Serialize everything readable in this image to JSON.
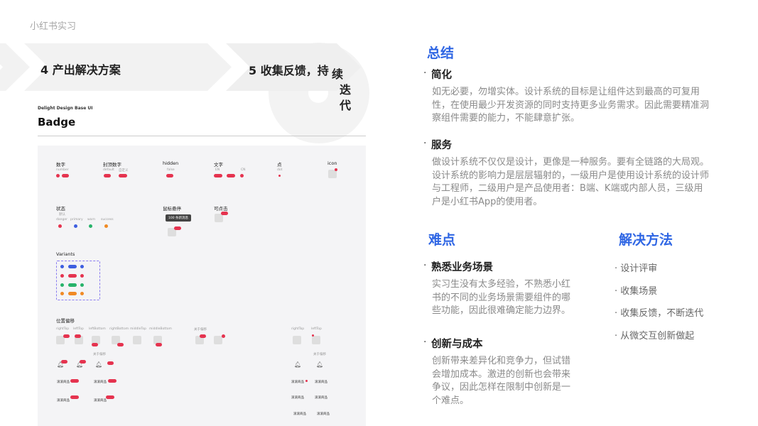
{
  "header": {
    "label": "小红书实习"
  },
  "process": {
    "step4": "4 产出解决方案",
    "step5_line1": "5 收集反馈，持",
    "step5_line2": "续",
    "step5_line3": "迭",
    "step5_line4": "代"
  },
  "doc": {
    "subtitle": "Delight Design Base UI",
    "title": "Badge",
    "sections": {
      "number": "数字",
      "capped": "封顶数字",
      "hidden": "hidden",
      "text": "文字",
      "dot": "点",
      "icon": "icon",
      "status": "状态",
      "hover": "鼠标悬停",
      "clickable": "可点击",
      "variants": "Variants",
      "offset": "位置偏移"
    },
    "small": {
      "number": "number",
      "default": "default",
      "custom": "自定义",
      "false": "false",
      "en": "EN",
      "cn": "CN",
      "dot": "dot",
      "default2": "默认",
      "danger": "danger",
      "primary": "primary",
      "warn": "warn",
      "success": "success",
      "tooltip": "100 条新消息",
      "rightTop": "rightTop",
      "leftTop": "leftTop",
      "leftBottom": "leftBottom",
      "rightBottom": "rightBottom",
      "middleTop": "middleTop",
      "middleBottom": "middleBottom",
      "custom_offset": "关于偏移",
      "rightTop2": "rightTop",
      "leftTop2": "leftTop",
      "custom_offset2": "关于偏移",
      "custom_offset3": "关于偏移",
      "item": "滚滚商品"
    }
  },
  "summary": {
    "title": "总结",
    "item1_head": "简化",
    "item1_text": "如无必要，勿增实体。设计系统的目标是让组件达到最高的可复用性，在使用最少开发资源的同时支持更多业务需求。因此需要精准洞察组件需要的能力，不能肆意扩张。",
    "item2_head": "服务",
    "item2_text": "做设计系统不仅仅是设计，更像是一种服务。要有全链路的大局观。设计系统的影响力是层层辐射的，一级用户是使用设计系统的设计师与工程师，二级用户是产品使用者：B端、K端或内部人员，三级用户是小红书App的使用者。"
  },
  "difficulty": {
    "title": "难点",
    "item1_head": "熟悉业务场景",
    "item1_text": "实习生没有太多经验，不熟悉小红书的不同的业务场景需要组件的哪些功能，因此很难确定能力边界。",
    "item2_head": "创新与成本",
    "item2_text": "创新带来差异化和竞争力，但试错会增加成本。激进的创新也会带来争议，因此怎样在限制中创新是一个难点。"
  },
  "solution": {
    "title": "解决方法",
    "items": [
      "设计评审",
      "收集场景",
      "收集反馈，不断迭代",
      "从微交互创新做起"
    ]
  },
  "colors": {
    "accent": "#2f66e4",
    "badge_red": "#e5334f",
    "badge_blue": "#3d5ee0",
    "badge_green": "#27b36a",
    "badge_orange": "#f08a24"
  }
}
